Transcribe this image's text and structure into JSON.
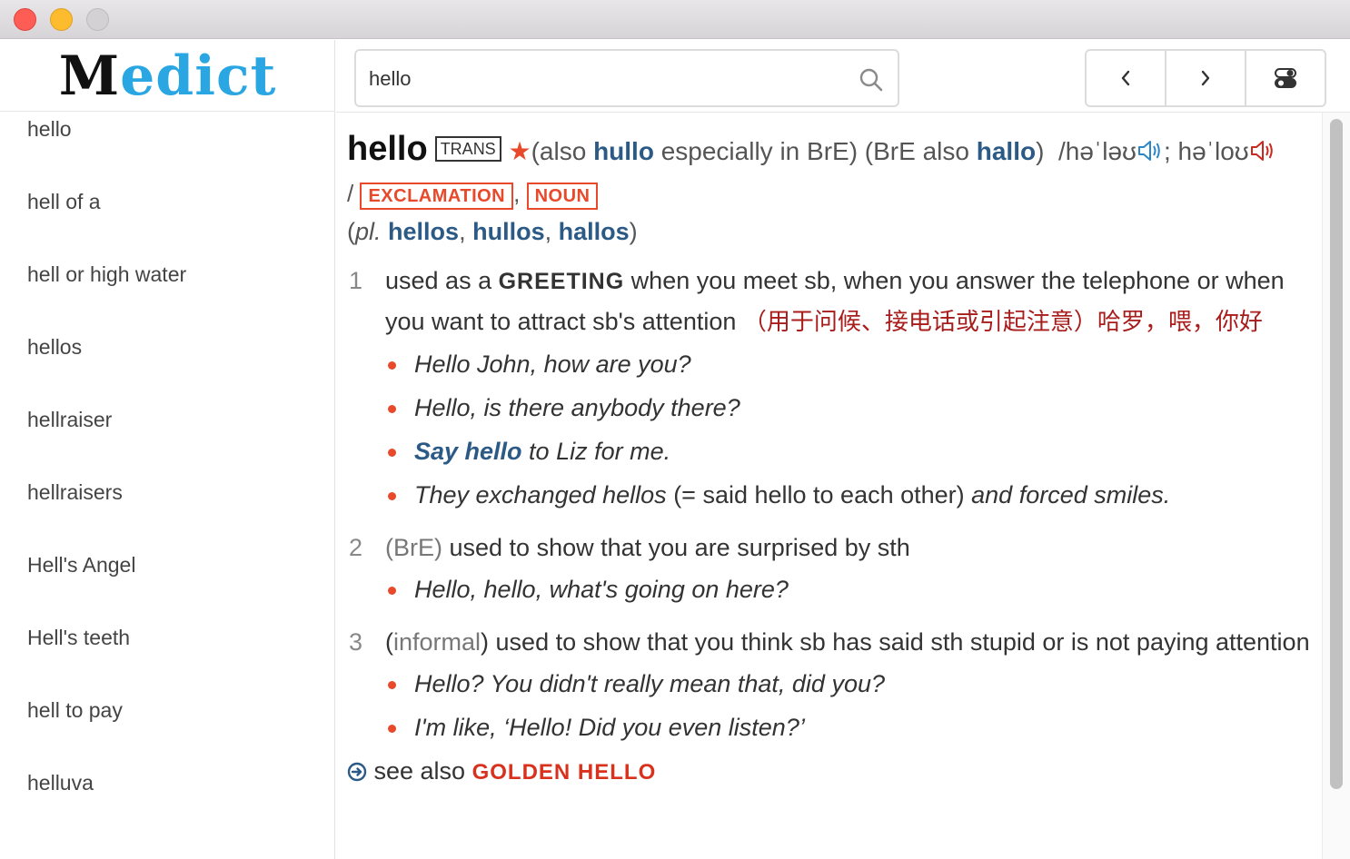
{
  "app": {
    "logo_first": "M",
    "logo_rest": "edict"
  },
  "search": {
    "value": "hello",
    "icon": "search-icon"
  },
  "nav": {
    "back_icon": "chevron-left-icon",
    "forward_icon": "chevron-right-icon",
    "settings_icon": "toggle-icon"
  },
  "word_list": [
    "hello",
    "hell of a",
    "hell or high water",
    "hellos",
    "hellraiser",
    "hellraisers",
    "Hell's Angel",
    "Hell's teeth",
    "hell to pay",
    "helluva"
  ],
  "entry": {
    "headword": "hello",
    "trans_label": "TRANS",
    "star": "★",
    "also_open": "(also ",
    "also_word": "hullo",
    "also_rest": " especially in BrE) (BrE also ",
    "also_word2": "hallo",
    "also_close": ")",
    "pron_bre": "/həˈləʊ",
    "pron_sep": "; ",
    "pron_ame": "həˈloʊ",
    "pos_slash": "/ ",
    "pos1": "EXCLAMATION",
    "pos_comma": ", ",
    "pos2": "NOUN",
    "pl_open": "(",
    "pl_label": "pl.",
    "pl_sp": " ",
    "plural1": "hellos",
    "plural_comma1": ", ",
    "plural2": "hullos",
    "plural_comma2": ", ",
    "plural3": "hallos",
    "pl_close": ")",
    "senses": [
      {
        "num": "1",
        "def_pre": "used as a ",
        "def_kw": "GREETING",
        "def_post": " when you meet sb, when you answer the telephone or when you want to attract sb's attention",
        "zh": "（用于问候、接电话或引起注意）哈罗，喂，你好",
        "examples": [
          {
            "text": "Hello John, how are you?"
          },
          {
            "text": "Hello, is there anybody there?"
          },
          {
            "link": "Say hello",
            "rest": " to Liz for me."
          },
          {
            "start": "They exchanged hellos",
            "mid": " (= said hello to each other) ",
            "end": "and forced smiles."
          }
        ]
      },
      {
        "num": "2",
        "reg": "(BrE)",
        "def": " used to show that you are surprised by sth",
        "examples": [
          {
            "text": "Hello, hello, what's going on here?"
          }
        ]
      },
      {
        "num": "3",
        "reg_open": "(",
        "reg": "informal",
        "reg_close": ")",
        "def": " used to show that you think sb has said sth stupid or is not paying attention",
        "examples": [
          {
            "text": "Hello? You didn't really mean that, did you?"
          },
          {
            "text": "I'm like, ‘Hello! Did you even listen?’"
          }
        ]
      }
    ],
    "see_also_label": " see also ",
    "see_also_target": "GOLDEN HELLO"
  },
  "colors": {
    "accent_red": "#e8492b",
    "link_blue": "#2b5a86",
    "chinese_red": "#a81c1c",
    "logo_blue": "#2aa6e3"
  }
}
